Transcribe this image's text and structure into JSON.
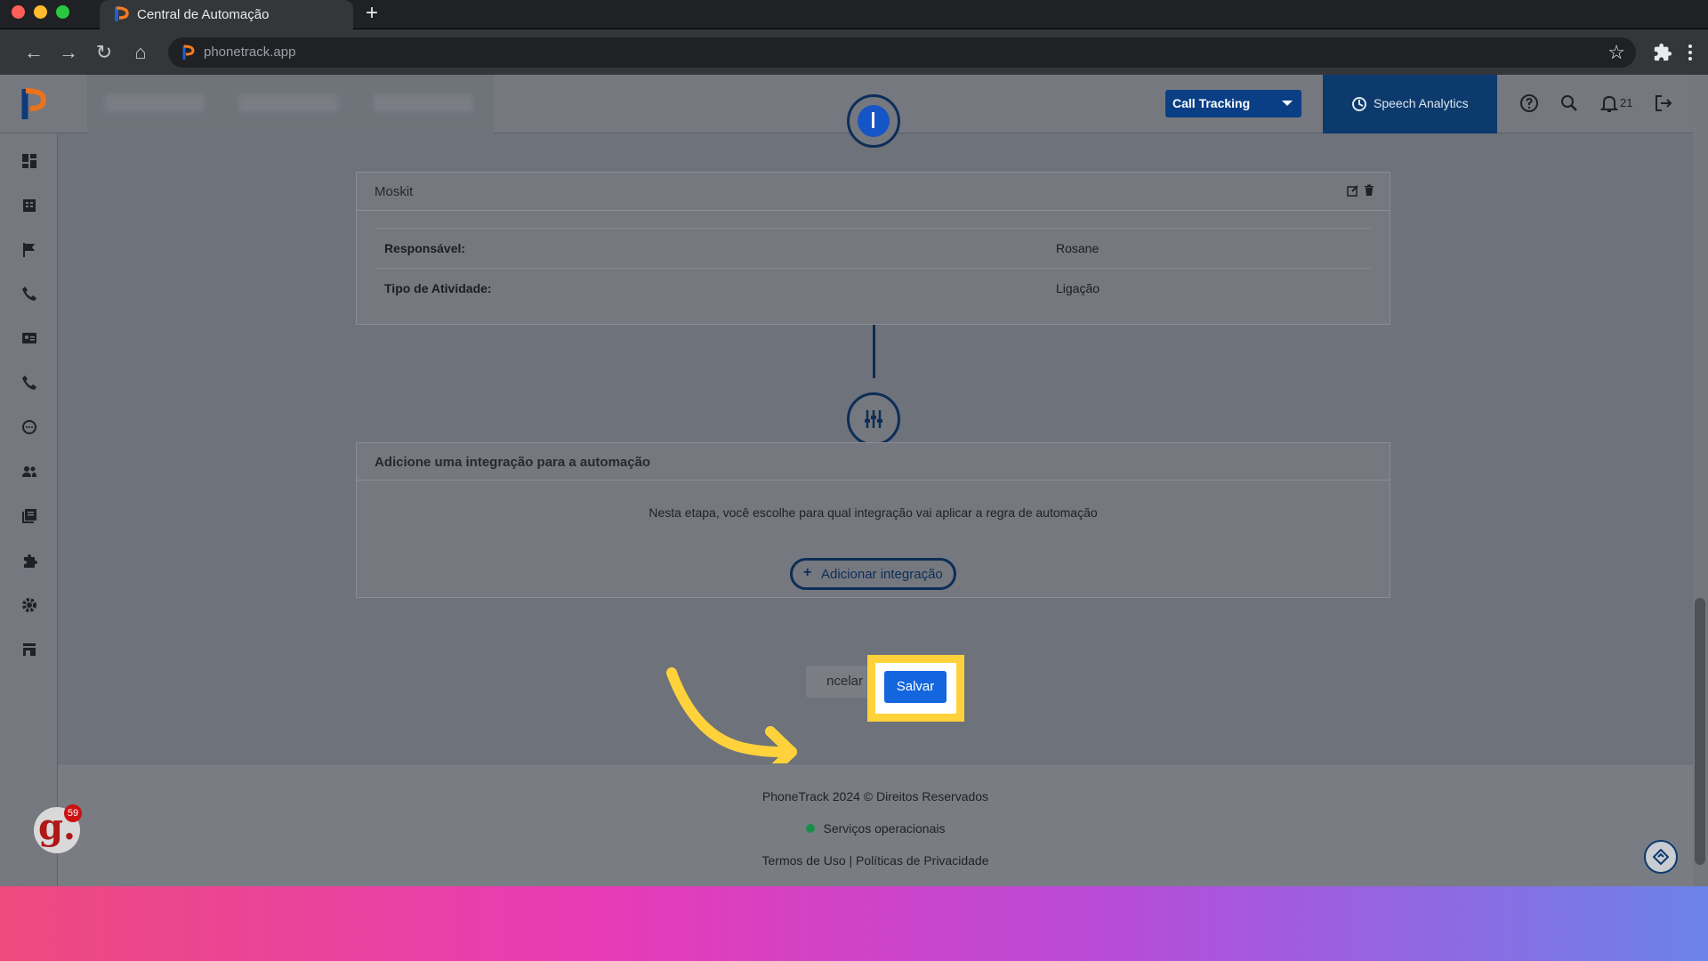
{
  "browser": {
    "tab_title": "Central de Automação",
    "new_tab_label": "+",
    "url": "phonetrack.app"
  },
  "header": {
    "product_select": "Call Tracking",
    "speech_analytics": "Speech Analytics",
    "notification_count": "21"
  },
  "sidebar": {
    "items": [
      "dashboard-icon",
      "building-icon",
      "flag-icon",
      "phone-icon",
      "contact-card-icon",
      "phone-icon",
      "chat-icon",
      "users-icon",
      "reports-icon",
      "puzzle-icon",
      "gear-icon",
      "store-icon"
    ]
  },
  "integration_card": {
    "title": "Moskit",
    "rows": [
      {
        "label": "Responsável:",
        "value": "Rosane"
      },
      {
        "label": "Tipo de Atividade:",
        "value": "Ligação"
      }
    ]
  },
  "add_integration_card": {
    "title": "Adicione uma integração para a automação",
    "description": "Nesta etapa, você escolhe para qual integração vai aplicar a regra de automação",
    "button_label": "Adicionar integração",
    "button_icon": "+"
  },
  "actions": {
    "cancel_label": "ncelar",
    "save_label": "Salvar"
  },
  "footer": {
    "copyright": "PhoneTrack 2024 © Direitos Reservados",
    "status": "Serviços operacionais",
    "links": "Termos de Uso | Políticas de Privacidade"
  },
  "widgets": {
    "g_badge_letter": "g.",
    "g_badge_count": "59"
  },
  "colors": {
    "brand_blue": "#1466de",
    "highlight_yellow": "#ffd23c",
    "status_green": "#1a8f4a"
  }
}
